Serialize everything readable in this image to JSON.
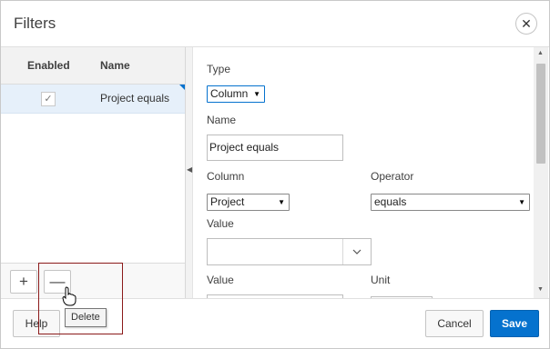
{
  "dialog": {
    "title": "Filters",
    "close_icon": "close-icon"
  },
  "grid": {
    "columns": [
      "Enabled",
      "Name"
    ],
    "rows": [
      {
        "enabled": true,
        "check_glyph": "✓",
        "name": "Project equals",
        "selected": true
      }
    ]
  },
  "left_footer": {
    "add_glyph": "+",
    "remove_glyph": "—",
    "tooltip": "Delete"
  },
  "form": {
    "type_label": "Type",
    "type_value": "Column",
    "name_label": "Name",
    "name_value": "Project equals",
    "column_label": "Column",
    "column_value": "Project",
    "operator_label": "Operator",
    "operator_value": "equals",
    "value_label": "Value",
    "value_value": "",
    "value2_label": "Value",
    "unit_label": "Unit"
  },
  "footer": {
    "help": "Help",
    "cancel": "Cancel",
    "save": "Save"
  },
  "colors": {
    "accent": "#0572ce",
    "selected_row": "#e6f0fa",
    "highlight_box": "#8b1a1a"
  }
}
